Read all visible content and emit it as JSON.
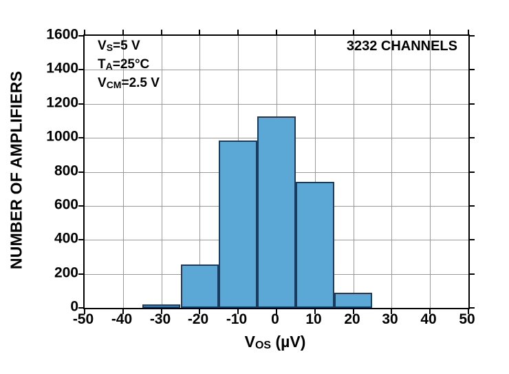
{
  "chart_data": {
    "type": "bar",
    "title": "",
    "subtitle": "",
    "xlabel": "VOS (µV)",
    "xlabel_parts": {
      "prefix": "V",
      "sub": "OS",
      "suffix": " (µV)"
    },
    "ylabel": "NUMBER OF AMPLIFIERS",
    "xlim": [
      -50,
      50
    ],
    "ylim": [
      0,
      1600
    ],
    "grid": true,
    "legend": "none",
    "bin_width": 10,
    "x_ticks": [
      -50,
      -40,
      -30,
      -20,
      -10,
      0,
      10,
      20,
      30,
      40,
      50
    ],
    "x_tick_labels": [
      "-50",
      "-40",
      "-30",
      "-20",
      "-10",
      "0",
      "10",
      "20",
      "30",
      "40",
      "50"
    ],
    "y_ticks": [
      0,
      200,
      400,
      600,
      800,
      1000,
      1200,
      1400,
      1600
    ],
    "y_tick_labels": [
      "0",
      "200",
      "400",
      "600",
      "800",
      "1000",
      "1200",
      "1400",
      "1600"
    ],
    "bars": [
      {
        "x_start": -35,
        "x_end": -25,
        "center": -30,
        "value": 20
      },
      {
        "x_start": -25,
        "x_end": -15,
        "center": -20,
        "value": 255
      },
      {
        "x_start": -15,
        "x_end": -5,
        "center": -10,
        "value": 985
      },
      {
        "x_start": -5,
        "x_end": 5,
        "center": 0,
        "value": 1128
      },
      {
        "x_start": 5,
        "x_end": 15,
        "center": 10,
        "value": 743
      },
      {
        "x_start": 15,
        "x_end": 25,
        "center": 20,
        "value": 88
      }
    ],
    "categories": [
      "-30",
      "-20",
      "-10",
      "0",
      "10",
      "20"
    ],
    "values": [
      20,
      255,
      985,
      1128,
      743,
      88
    ],
    "annotations": [
      {
        "name": "conditions",
        "lines": [
          "VS=5 V",
          "TA=25°C",
          "VCM=2.5 V"
        ]
      },
      {
        "name": "channel-count",
        "text": "3232 CHANNELS"
      }
    ],
    "colors": {
      "bar_fill": "#5ba7d6",
      "bar_edge": "#1b3a5c",
      "grid": "#9a9a9a",
      "axis": "#000000",
      "background": "#ffffff"
    }
  },
  "annotations": {
    "conditions": {
      "line1_prefix": "V",
      "line1_sub": "S",
      "line1_suffix": "=5 V",
      "line2_prefix": "T",
      "line2_sub": "A",
      "line2_suffix": "=25°C",
      "line3_prefix": "V",
      "line3_sub": "CM",
      "line3_suffix": "=2.5 V"
    },
    "channels": "3232 CHANNELS"
  }
}
